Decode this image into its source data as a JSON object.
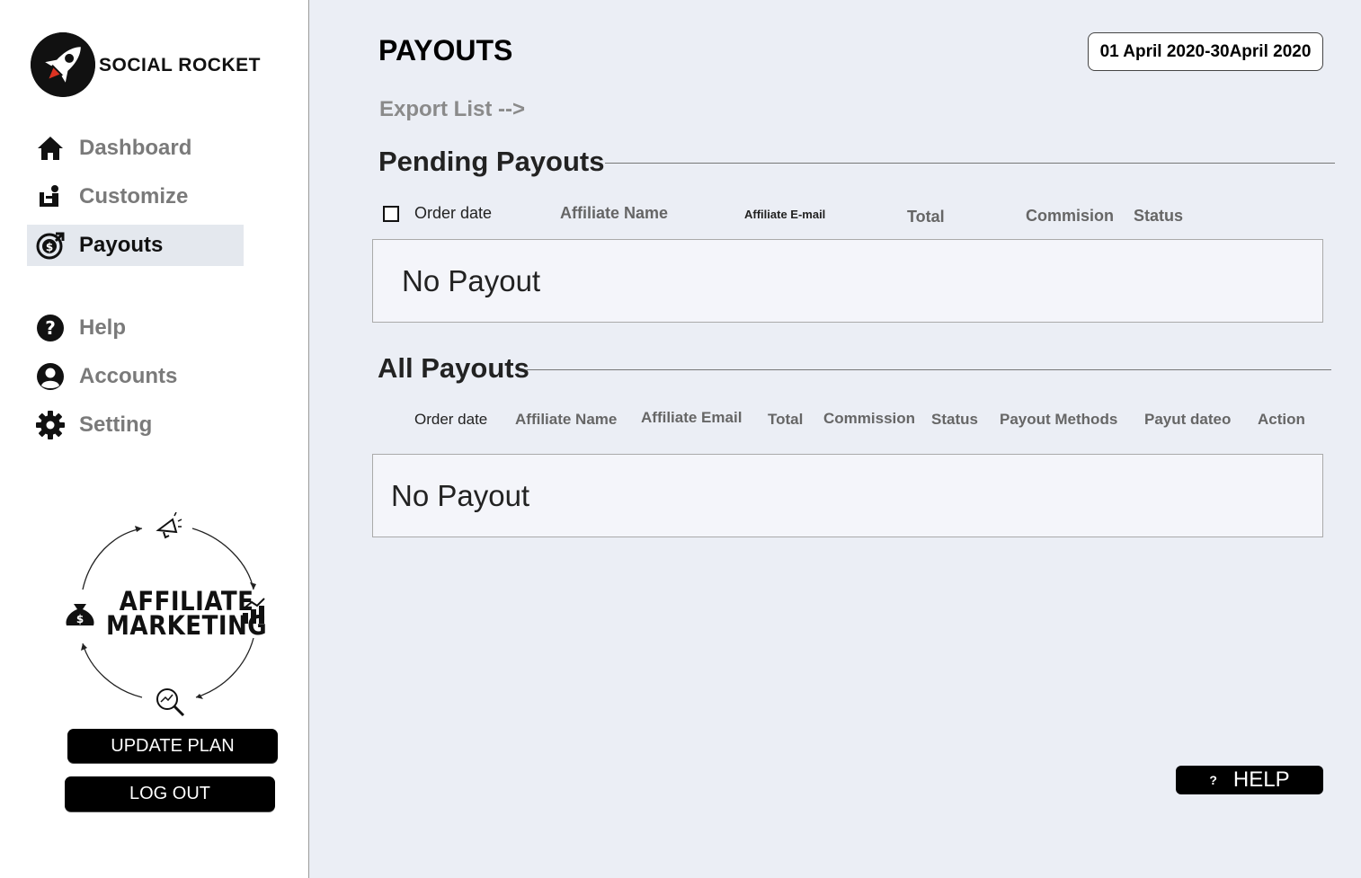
{
  "brand": {
    "name": "SOCIAL ROCKET"
  },
  "sidebar": {
    "items": [
      {
        "label": "Dashboard",
        "icon": "home-icon"
      },
      {
        "label": "Customize",
        "icon": "customize-icon"
      },
      {
        "label": "Payouts",
        "icon": "payouts-icon",
        "active": true
      },
      {
        "label": "Help",
        "icon": "help-icon"
      },
      {
        "label": "Accounts",
        "icon": "account-icon"
      },
      {
        "label": "Setting",
        "icon": "gear-icon"
      }
    ],
    "promo": {
      "line1": "AFFILIATE",
      "line2": "MARKETING"
    },
    "update_plan_label": "UPDATE PLAN",
    "logout_label": "LOG OUT"
  },
  "main": {
    "title": "PAYOUTS",
    "date_range": "01 April 2020-30April 2020",
    "export_label": "Export List -->",
    "pending": {
      "title": "Pending Payouts",
      "columns": [
        "Order date",
        "Affiliate Name",
        "Affiliate E-mail",
        "Total",
        "Commision",
        "Status"
      ],
      "empty_text": "No Payout"
    },
    "all": {
      "title": "All Payouts",
      "columns": [
        "Order date",
        "Affiliate Name",
        "Affiliate Email",
        "Total",
        "Commission",
        "Status",
        "Payout Methods",
        "Payut dateo",
        "Action"
      ],
      "empty_text": "No Payout"
    },
    "help_button": {
      "icon_text": "?",
      "label": "HELP"
    }
  }
}
